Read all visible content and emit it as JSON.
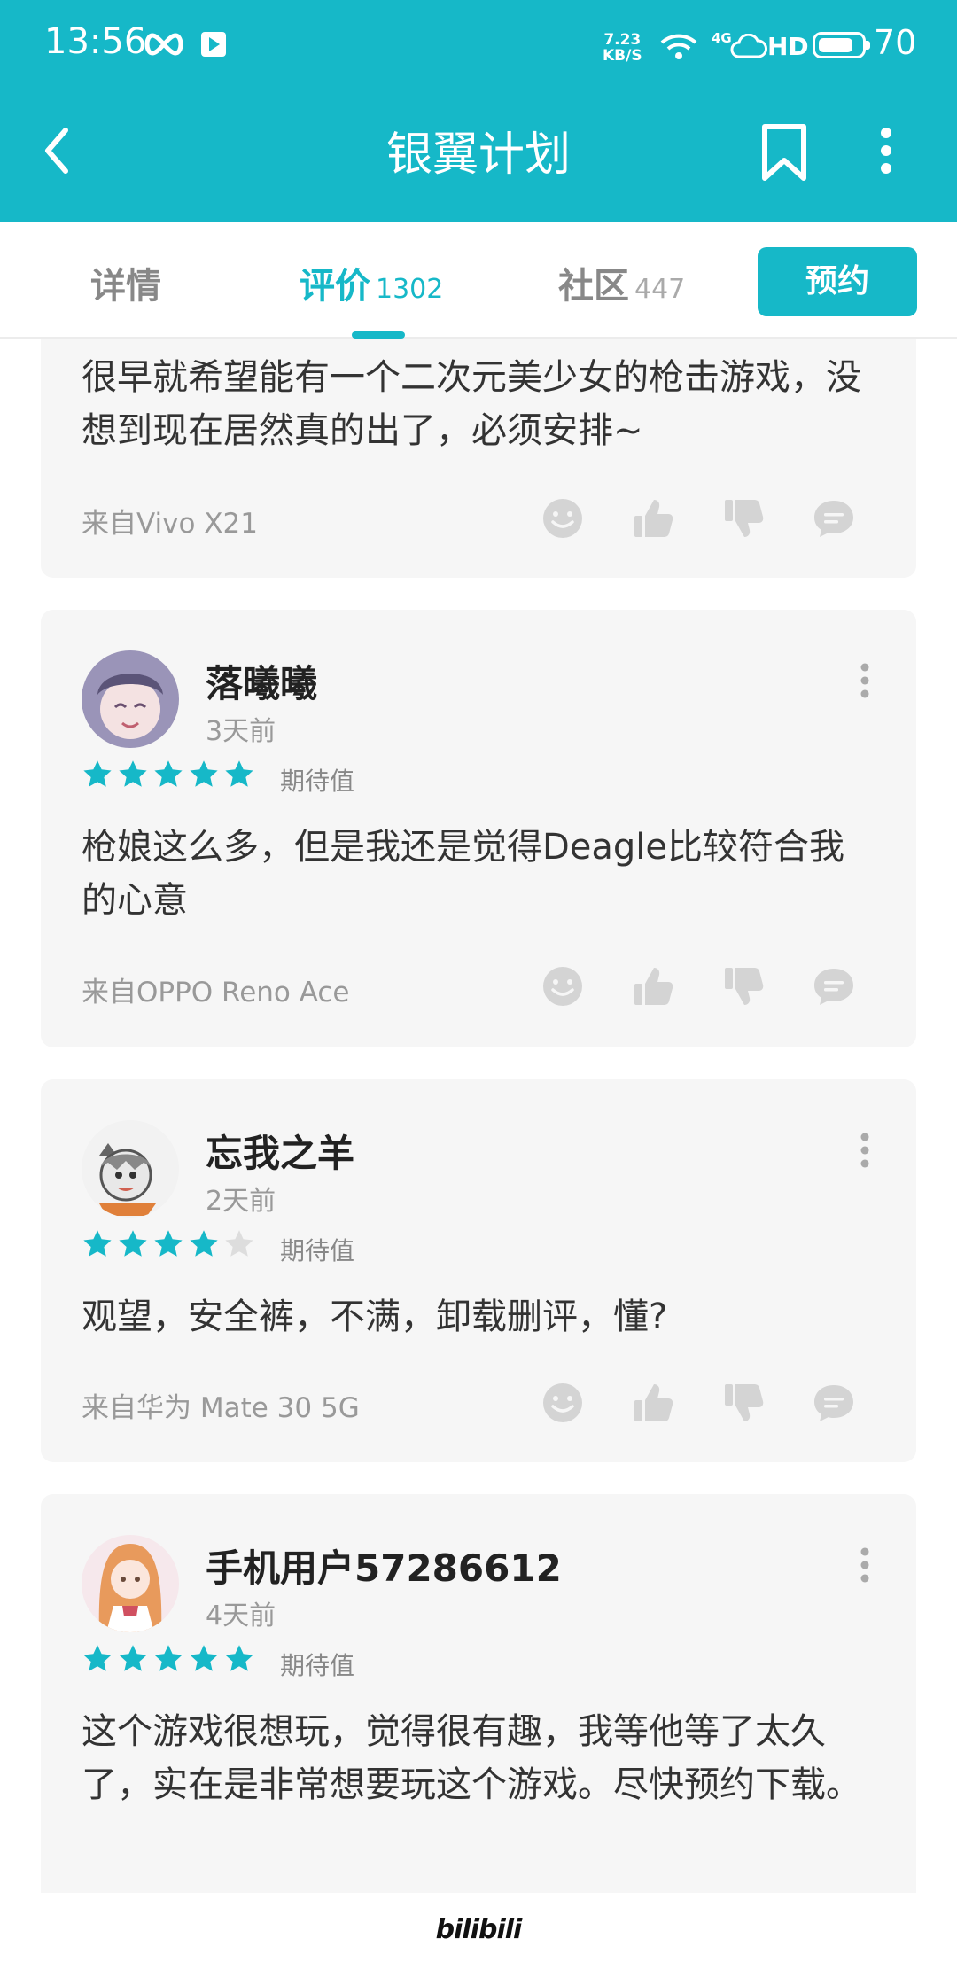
{
  "status_bar": {
    "time": "13:56",
    "net_speed_value": "7.23",
    "net_speed_unit": "KB/S",
    "network": "4G",
    "hd": "HD",
    "battery_level": "70"
  },
  "header": {
    "title": "银翼计划",
    "back_icon": "back-arrow-icon",
    "bookmark_icon": "bookmark-icon",
    "more_icon": "more-vertical-icon"
  },
  "tabs": [
    {
      "label": "详情",
      "count": ""
    },
    {
      "label": "评价",
      "count": "1302",
      "active": true
    },
    {
      "label": "社区",
      "count": "447"
    }
  ],
  "reserve_button": "预约",
  "reviews": [
    {
      "user": "",
      "time": "",
      "content": "很早就希望能有一个二次元美少女的枪击游戏，没想到现在居然真的出了，必须安排~",
      "source": "来自Vivo X21"
    },
    {
      "user": "落曦曦",
      "time": "3天前",
      "rating": 5,
      "rating_label": "期待值",
      "content": "枪娘这么多，但是我还是觉得Deagle比较符合我的心意",
      "source": "来自OPPO Reno Ace"
    },
    {
      "user": "忘我之羊",
      "time": "2天前",
      "rating": 4,
      "rating_label": "期待值",
      "content": "观望，安全裤，不满，卸载删评，懂?",
      "source": "来自华为 Mate 30 5G"
    },
    {
      "user": "手机用户57286612",
      "time": "4天前",
      "rating": 5,
      "rating_label": "期待值",
      "content": "这个游戏很想玩，觉得很有趣，我等他等了太久了，实在是非常想要玩这个游戏。尽快预约下载。",
      "source": ""
    }
  ],
  "action_icons": [
    "emoji-icon",
    "thumbs-up-icon",
    "thumbs-down-icon",
    "comment-icon"
  ],
  "colors": {
    "accent": "#16b8c8",
    "card_bg": "#f6f6f6",
    "icon_gray": "#d2d2d2"
  },
  "watermark": "bilibili"
}
